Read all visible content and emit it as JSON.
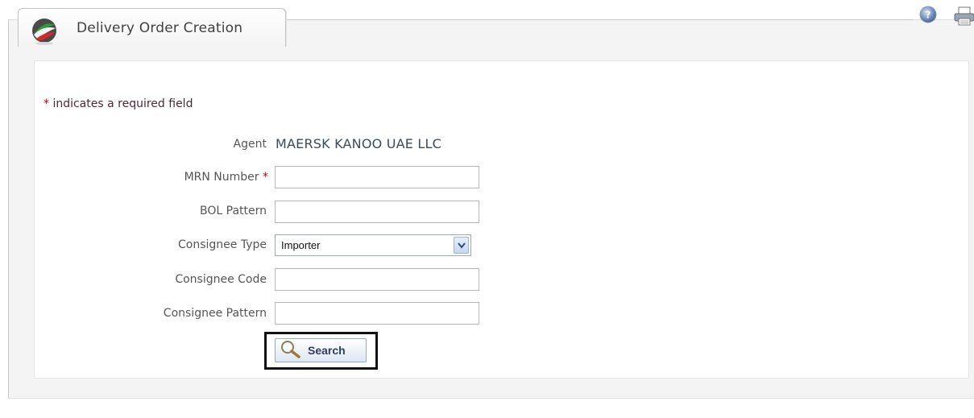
{
  "tab": {
    "title": "Delivery Order Creation",
    "logo_icon": "app-logo-icon"
  },
  "top_icons": {
    "help": "help-icon",
    "print": "print-icon"
  },
  "form": {
    "required_note_star": "*",
    "required_note": " indicates a required field",
    "agent": {
      "label": "Agent",
      "value": "MAERSK KANOO UAE LLC"
    },
    "mrn": {
      "label": "MRN Number",
      "required_star": "*",
      "value": ""
    },
    "bol_pattern": {
      "label": "BOL Pattern",
      "value": ""
    },
    "consignee_type": {
      "label": "Consignee Type",
      "selected": "Importer"
    },
    "consignee_code": {
      "label": "Consignee Code",
      "value": ""
    },
    "consignee_pattern": {
      "label": "Consignee Pattern",
      "value": ""
    },
    "search_button": {
      "label": "Search",
      "icon": "magnifier-icon"
    }
  }
}
